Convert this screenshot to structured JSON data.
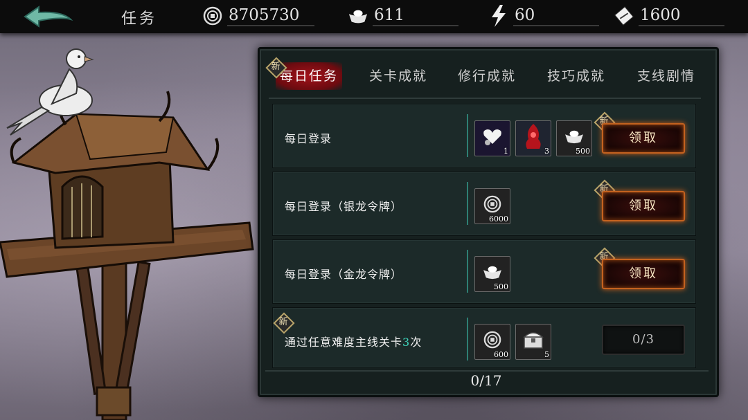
{
  "topbar": {
    "title": "任务",
    "resources": [
      {
        "icon": "coin-icon",
        "value": "8705730"
      },
      {
        "icon": "silver-ingot-icon",
        "value": "611"
      },
      {
        "icon": "lightning-icon",
        "value": "60"
      },
      {
        "icon": "ticket-icon",
        "value": "1600"
      }
    ]
  },
  "tabs": [
    {
      "label": "每日任务",
      "active": true,
      "new": "新"
    },
    {
      "label": "关卡成就",
      "active": false
    },
    {
      "label": "修行成就",
      "active": false
    },
    {
      "label": "技巧成就",
      "active": false
    },
    {
      "label": "支线剧情",
      "active": false
    }
  ],
  "tasks": [
    {
      "title": "每日登录",
      "new": "新",
      "rewards": [
        {
          "icon": "heart-bird-card-icon",
          "count": "1"
        },
        {
          "icon": "red-spirit-card-icon",
          "count": "3"
        },
        {
          "icon": "silver-ingot-icon",
          "count": "500"
        }
      ],
      "button": "领取"
    },
    {
      "title": "每日登录（银龙令牌）",
      "new": "新",
      "rewards": [
        {
          "icon": "coin-icon",
          "count": "6000"
        }
      ],
      "button": "领取"
    },
    {
      "title": "每日登录（金龙令牌）",
      "new": "新",
      "rewards": [
        {
          "icon": "silver-ingot-icon",
          "count": "500"
        }
      ],
      "button": "领取"
    },
    {
      "title_prefix": "通过任意难度主线关卡",
      "title_highlight": "3",
      "title_suffix": "次",
      "new": "新",
      "rewards": [
        {
          "icon": "coin-icon",
          "count": "600"
        },
        {
          "icon": "treasure-chest-icon",
          "count": "5"
        }
      ],
      "progress": "0/3"
    }
  ],
  "footer": {
    "progress": "0/17"
  },
  "colors": {
    "accent_red": "#a3121a",
    "button_glow": "#c4621f",
    "highlight": "#3fd6bd"
  }
}
